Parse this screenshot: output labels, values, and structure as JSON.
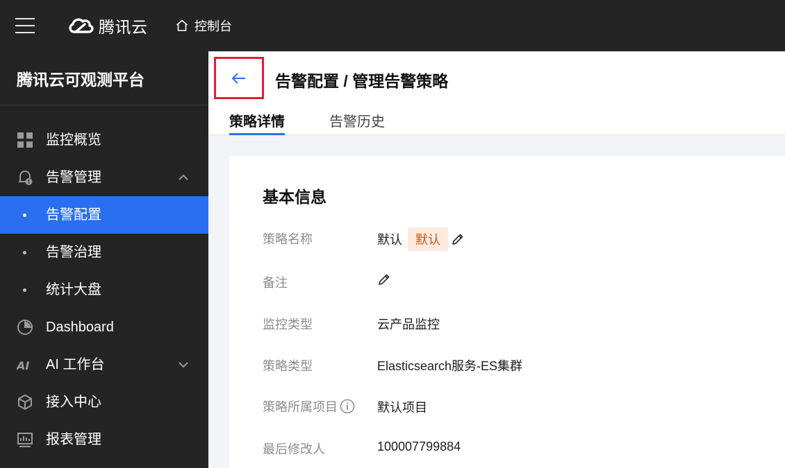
{
  "topbar": {
    "menu_icon": "hamburger-menu-icon",
    "logo_text": "腾讯云",
    "console_label": "控制台"
  },
  "sidebar": {
    "title": "腾讯云可观测平台",
    "items": [
      {
        "label": "监控概览",
        "icon": "grid-icon"
      },
      {
        "label": "告警管理",
        "icon": "bell-icon",
        "expanded": true
      },
      {
        "label": "告警配置",
        "sub": true,
        "active": true
      },
      {
        "label": "告警治理",
        "sub": true
      },
      {
        "label": "统计大盘",
        "sub": true
      },
      {
        "label": "Dashboard",
        "icon": "pie-chart-icon"
      },
      {
        "label": "AI 工作台",
        "icon": "ai-icon",
        "expanded": false
      },
      {
        "label": "接入中心",
        "icon": "cube-icon"
      },
      {
        "label": "报表管理",
        "icon": "report-icon"
      }
    ]
  },
  "header": {
    "title": "告警配置 / 管理告警策略",
    "tabs": [
      {
        "label": "策略详情",
        "active": true
      },
      {
        "label": "告警历史",
        "active": false
      }
    ]
  },
  "basic_info": {
    "title": "基本信息",
    "fields": [
      {
        "label": "策略名称",
        "value": "默认",
        "tag": "默认",
        "editable": true
      },
      {
        "label": "备注",
        "value": "",
        "editable": true
      },
      {
        "label": "监控类型",
        "value": "云产品监控"
      },
      {
        "label": "策略类型",
        "value": "Elasticsearch服务-ES集群"
      },
      {
        "label": "策略所属项目",
        "value": "默认项目",
        "info": true
      },
      {
        "label": "最后修改人",
        "value": "100007799884"
      }
    ]
  },
  "colors": {
    "sidebar_bg": "#242424",
    "active_blue": "#2a6ff0",
    "highlight_red": "#e0202c",
    "tag_bg": "#ffeadf",
    "tag_text": "#c25a17"
  }
}
